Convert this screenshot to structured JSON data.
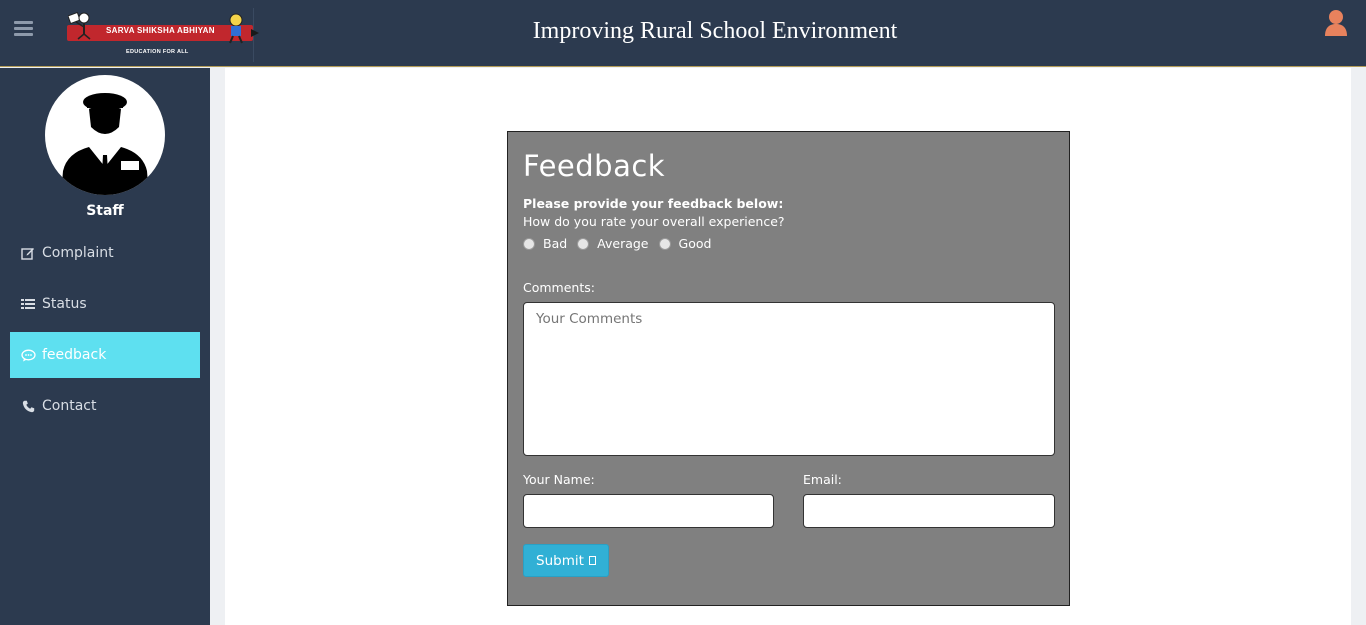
{
  "header": {
    "app_title": "Improving Rural School Environment",
    "logo_title": "SARVA SHIKSHA ABHIYAN",
    "logo_subtitle": "EDUCATION FOR ALL",
    "menu_icon": "hamburger-icon",
    "user_icon": "user-icon",
    "user_icon_color": "#e8825d"
  },
  "sidebar": {
    "role": "Staff",
    "items": [
      {
        "label": "Complaint",
        "icon": "edit-icon"
      },
      {
        "label": "Status",
        "icon": "list-icon"
      },
      {
        "label": "feedback",
        "icon": "comment-icon",
        "active": true
      },
      {
        "label": "Contact",
        "icon": "phone-icon"
      }
    ],
    "active_color": "#5ee0f0"
  },
  "form": {
    "title": "Feedback",
    "intro": "Please provide your feedback below:",
    "question": "How do you rate your overall experience?",
    "ratings": [
      "Bad",
      "Average",
      "Good"
    ],
    "comments_label": "Comments:",
    "comments_placeholder": "Your Comments",
    "name_label": "Your Name:",
    "email_label": "Email:",
    "submit_label": "Submit"
  },
  "colors": {
    "header_bg": "#2c3a4f",
    "panel_bg": "#808080",
    "submit_bg": "#31b0d5"
  }
}
